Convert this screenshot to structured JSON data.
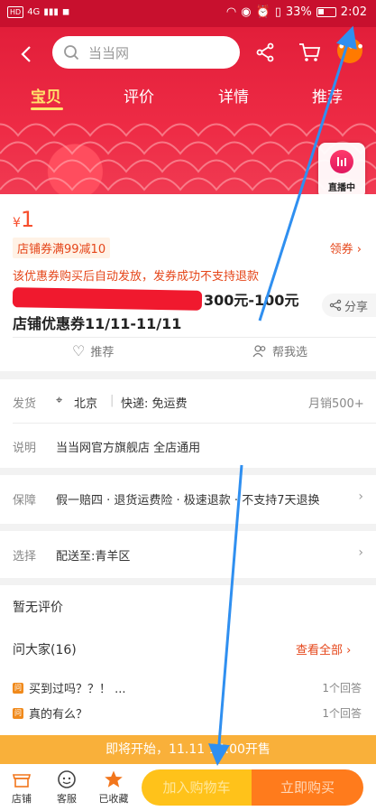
{
  "status_bar": {
    "net_chip": "HD",
    "net_type": "4G",
    "battery_pct": "33%",
    "time": "2:02"
  },
  "header": {
    "search_placeholder": "当当网",
    "more_label": "•••",
    "tabs": [
      "宝贝",
      "评价",
      "详情",
      "推荐"
    ],
    "live_label": "直播中"
  },
  "product": {
    "currency": "¥",
    "price": "1",
    "coupon_tag": "店铺券满99减10",
    "get_coupon": "领券",
    "coupon_note": "该优惠券购买后自动发放，发券成功不支持退款",
    "title_line1_visible": "300元-100元",
    "title_line2": "店铺优惠券11/11-11/11",
    "share": "分享",
    "recommend": "推荐",
    "help_choose": "帮我选"
  },
  "shipping": {
    "label": "发货",
    "location": "北京",
    "express": "快递: 免运费",
    "monthly_sales": "月销500+"
  },
  "description": {
    "label": "说明",
    "text": "当当网官方旗舰店 全店通用"
  },
  "guarantee": {
    "label": "保障",
    "text": "假一赔四 · 退货运费险 · 极速退款 · 不支持7天退换"
  },
  "select": {
    "label": "选择",
    "text": "配送至:青羊区"
  },
  "reviews": {
    "empty": "暂无评价"
  },
  "qa": {
    "title": "问大家(16)",
    "view_all": "查看全部",
    "icon_char": "问",
    "items": [
      {
        "question": "买到过吗？？！ ...",
        "answers": "1个回答"
      },
      {
        "question": "真的有么？",
        "answers": "1个回答"
      }
    ]
  },
  "notice": "即将开始，11.11 14:00开售",
  "bottom_bar": {
    "shop": "店铺",
    "service": "客服",
    "favorited": "已收藏",
    "add_to_cart": "加入购物车",
    "buy_now": "立即购买"
  }
}
